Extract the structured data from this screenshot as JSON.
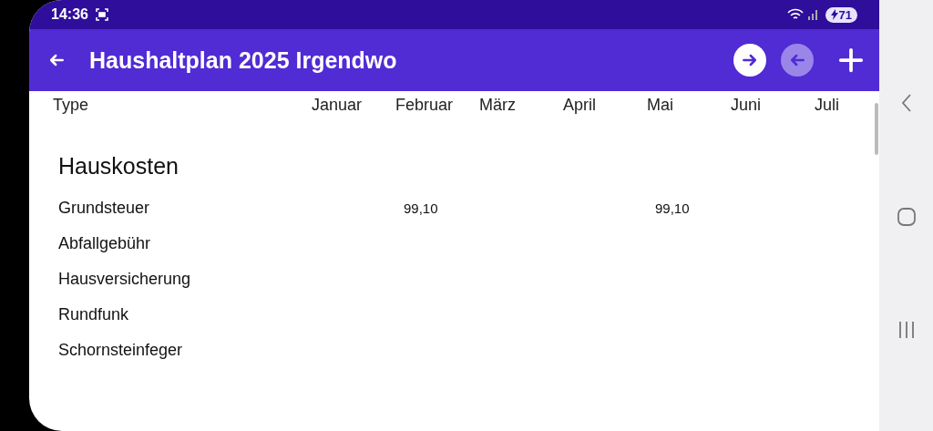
{
  "status_bar": {
    "time": "14:36",
    "battery": "71"
  },
  "app_bar": {
    "title": "Haushaltplan 2025 Irgendwo",
    "actions": [
      {
        "kind": "forward",
        "disabled": false
      },
      {
        "kind": "back",
        "disabled": true
      },
      {
        "kind": "add",
        "disabled": false
      }
    ]
  },
  "table": {
    "columns": [
      "Type",
      "Januar",
      "Februar",
      "März",
      "April",
      "Mai",
      "Juni",
      "Juli"
    ],
    "groups": [
      {
        "title": "Hauskosten",
        "rows": [
          {
            "type": "Grundsteuer",
            "values": [
              {
                "kind": "blank"
              },
              {
                "kind": "amount",
                "value": "99,10"
              },
              {
                "kind": "blank"
              },
              {
                "kind": "blank"
              },
              {
                "kind": "amount",
                "value": "99,10"
              },
              {
                "kind": "blank"
              },
              {
                "kind": "blank"
              }
            ]
          },
          {
            "type": "Abfallgebühr"
          },
          {
            "type": "Hausversicherung"
          },
          {
            "type": "Rundfunk"
          },
          {
            "type": "Schornsteinfeger"
          }
        ]
      }
    ]
  }
}
